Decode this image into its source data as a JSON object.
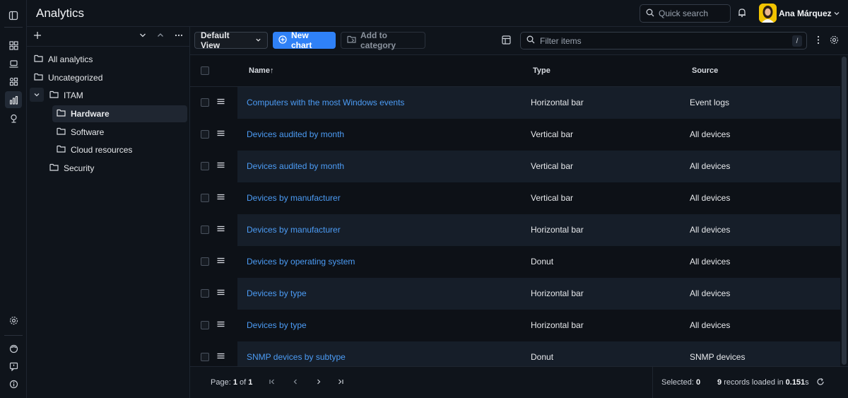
{
  "header": {
    "title": "Analytics",
    "quick_search_placeholder": "Quick search",
    "user_name": "Ana Márquez"
  },
  "sidebar": {
    "tree": [
      {
        "label": "All analytics"
      },
      {
        "label": "Uncategorized"
      },
      {
        "label": "ITAM",
        "expanded": true
      },
      {
        "label": "Hardware",
        "selected": true
      },
      {
        "label": "Software"
      },
      {
        "label": "Cloud resources"
      },
      {
        "label": "Security"
      }
    ]
  },
  "toolbar": {
    "view_label": "Default View",
    "new_chart_label": "New chart",
    "add_category_label": "Add to category",
    "filter_placeholder": "Filter items",
    "filter_shortcut": "/"
  },
  "grid": {
    "columns": {
      "name": "Name",
      "name_sort": "↑",
      "type": "Type",
      "source": "Source"
    },
    "rows": [
      {
        "name": "Computers with the most Windows events",
        "type": "Horizontal bar",
        "source": "Event logs"
      },
      {
        "name": "Devices audited by month",
        "type": "Vertical bar",
        "source": "All devices"
      },
      {
        "name": "Devices audited by month",
        "type": "Vertical bar",
        "source": "All devices"
      },
      {
        "name": "Devices by manufacturer",
        "type": "Vertical bar",
        "source": "All devices"
      },
      {
        "name": "Devices by manufacturer",
        "type": "Horizontal bar",
        "source": "All devices"
      },
      {
        "name": "Devices by operating system",
        "type": "Donut",
        "source": "All devices"
      },
      {
        "name": "Devices by type",
        "type": "Horizontal bar",
        "source": "All devices"
      },
      {
        "name": "Devices by type",
        "type": "Horizontal bar",
        "source": "All devices"
      },
      {
        "name": "SNMP devices by subtype",
        "type": "Donut",
        "source": "SNMP devices"
      }
    ]
  },
  "footer": {
    "page_prefix": "Page:",
    "page_current": "1",
    "page_of": "of",
    "page_total": "1",
    "selected_label": "Selected:",
    "selected_count": "0",
    "records_count": "9",
    "records_text": "records loaded in",
    "load_time": "0.151",
    "load_unit": "s"
  },
  "colors": {
    "accent": "#2f81f7",
    "link": "#4c9cf5",
    "avatar_bg": "#f2c300"
  }
}
